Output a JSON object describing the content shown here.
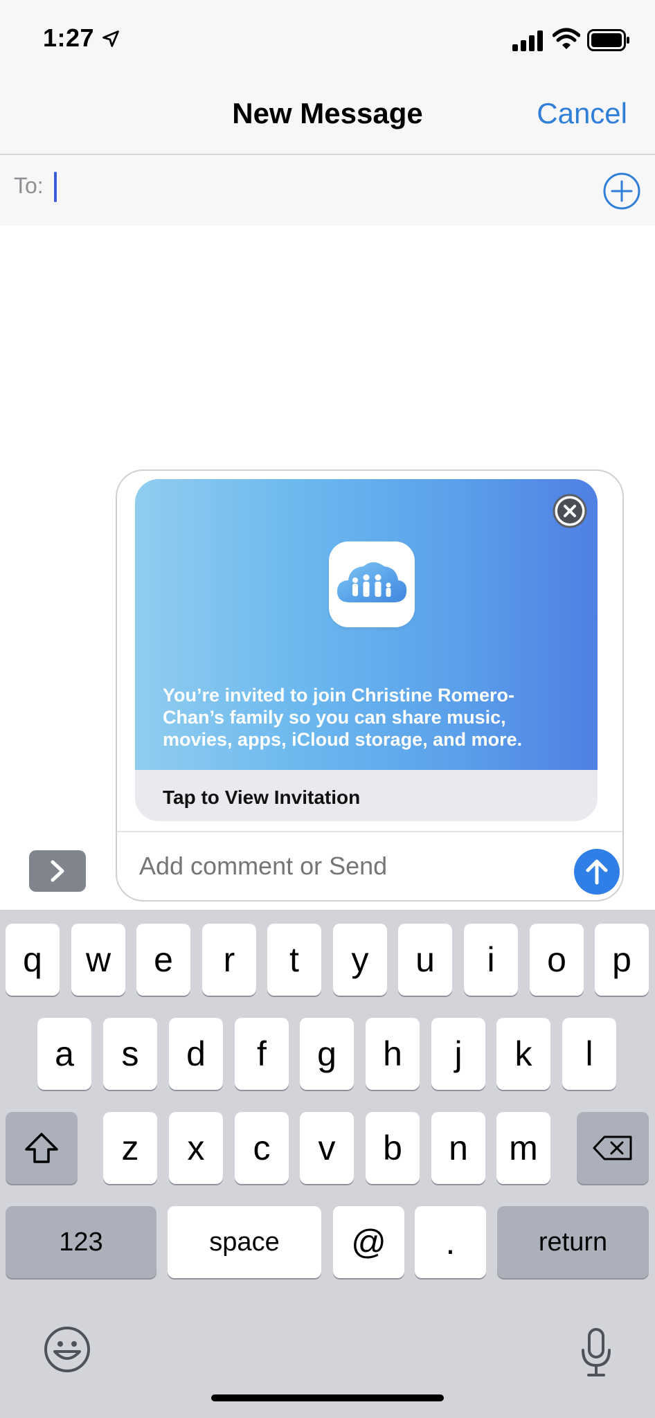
{
  "status": {
    "time": "1:27"
  },
  "header": {
    "title": "New Message",
    "cancel_label": "Cancel"
  },
  "to_field": {
    "label": "To:"
  },
  "invitation": {
    "text": "You’re invited to join Christine Romero-Chan’s family so you can share music, movies, apps, iCloud storage, and more.",
    "action_label": "Tap to View Invitation"
  },
  "comment": {
    "placeholder": "Add comment or Send"
  },
  "keyboard": {
    "row1": [
      "q",
      "w",
      "e",
      "r",
      "t",
      "y",
      "u",
      "i",
      "o",
      "p"
    ],
    "row2": [
      "a",
      "s",
      "d",
      "f",
      "g",
      "h",
      "j",
      "k",
      "l"
    ],
    "row3": [
      "z",
      "x",
      "c",
      "v",
      "b",
      "n",
      "m"
    ],
    "numbers_label": "123",
    "space_label": "space",
    "at_label": "@",
    "dot_label": ".",
    "return_label": "return"
  },
  "colors": {
    "accent": "#2f7fd8",
    "send_button": "#2f7fe6",
    "card_gradient_start": "#91cdef",
    "card_gradient_end": "#4f7fe4"
  }
}
